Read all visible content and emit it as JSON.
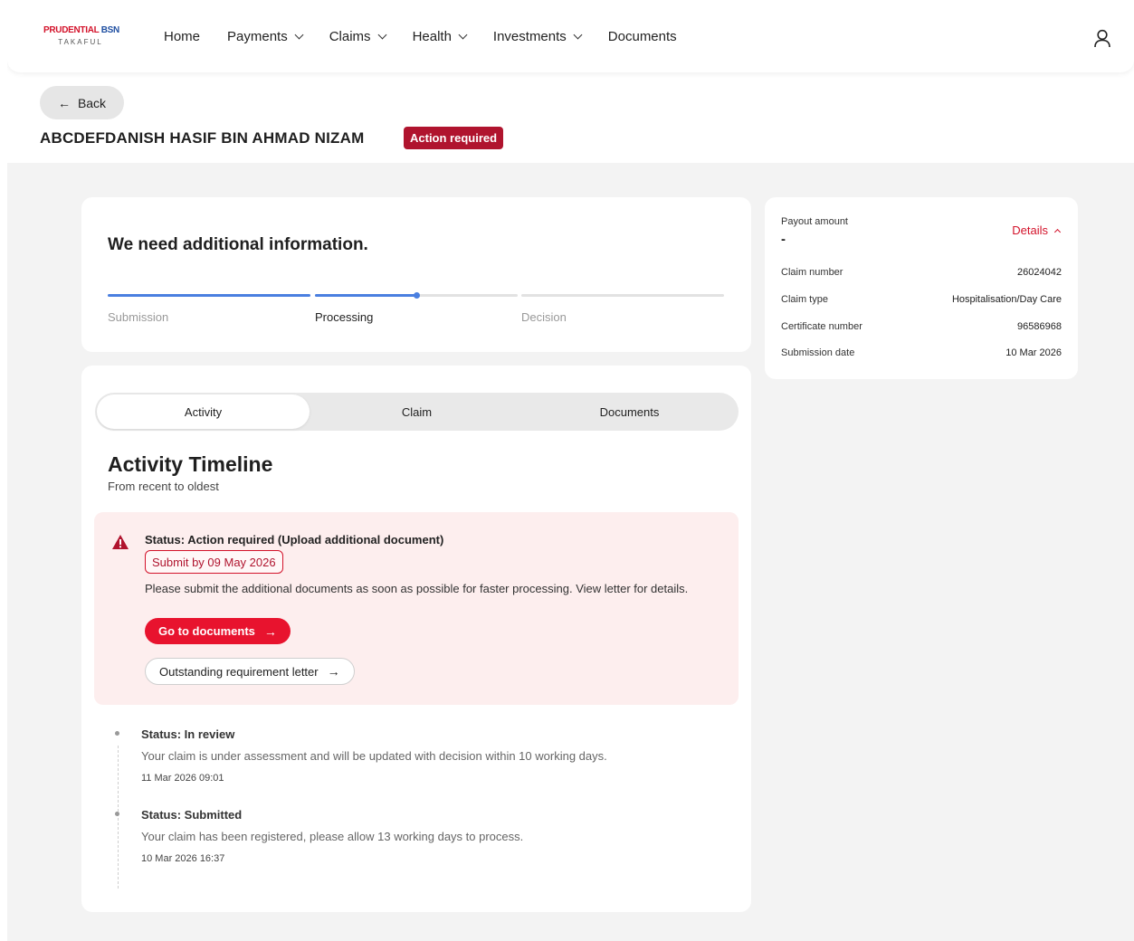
{
  "brand": {
    "logo_top_red": "PRUDENTIAL",
    "logo_top_blue": "BSN",
    "logo_bottom": "TAKAFUL"
  },
  "nav": {
    "items": [
      {
        "label": "Home",
        "has_dropdown": false
      },
      {
        "label": "Payments",
        "has_dropdown": true
      },
      {
        "label": "Claims",
        "has_dropdown": true
      },
      {
        "label": "Health",
        "has_dropdown": true
      },
      {
        "label": "Investments",
        "has_dropdown": true
      },
      {
        "label": "Documents",
        "has_dropdown": false
      }
    ],
    "user_icon": "user-icon"
  },
  "header": {
    "back_label": "Back",
    "title": "ABCDEFDANISH HASIF BIN AHMAD NIZAM",
    "status_badge": "Action required"
  },
  "progress": {
    "heading": "We need additional information.",
    "steps": [
      {
        "label": "Submission",
        "state": "done"
      },
      {
        "label": "Processing",
        "state": "current",
        "fill": 0.5
      },
      {
        "label": "Decision",
        "state": "pending"
      }
    ]
  },
  "summary": {
    "payout_label": "Payout amount",
    "payout_value": "-",
    "details_label": "Details",
    "rows": [
      {
        "label": "Claim number",
        "value": "26024042"
      },
      {
        "label": "Claim type",
        "value": "Hospitalisation/Day Care"
      },
      {
        "label": "Certificate number",
        "value": "96586968"
      },
      {
        "label": "Submission date",
        "value": "10 Mar 2026"
      }
    ]
  },
  "tabs": [
    {
      "label": "Activity",
      "active": true
    },
    {
      "label": "Claim",
      "active": false
    },
    {
      "label": "Documents",
      "active": false
    }
  ],
  "timeline": {
    "title": "Activity Timeline",
    "subtitle": "From recent to oldest",
    "alert": {
      "status": "Status: Action required (Upload additional document)",
      "deadline": "Submit by 09 May 2026",
      "description": "Please submit the additional documents as soon as possible for faster processing. View letter for details.",
      "primary_button": "Go to documents",
      "secondary_button": "Outstanding requirement letter"
    },
    "events": [
      {
        "status": "Status: In review",
        "description": "Your claim is under assessment and will be updated with decision within 10 working days.",
        "time": "11 Mar 2026 09:01"
      },
      {
        "status": "Status: Submitted",
        "description": "Your claim has been registered, please allow 13 working days to process.",
        "time": "10 Mar 2026 16:37"
      }
    ]
  },
  "colors": {
    "brand_red": "#d3132b",
    "badge_red": "#b0142e",
    "progress_blue": "#4a7fe0",
    "alert_bg": "#fdeeee"
  }
}
